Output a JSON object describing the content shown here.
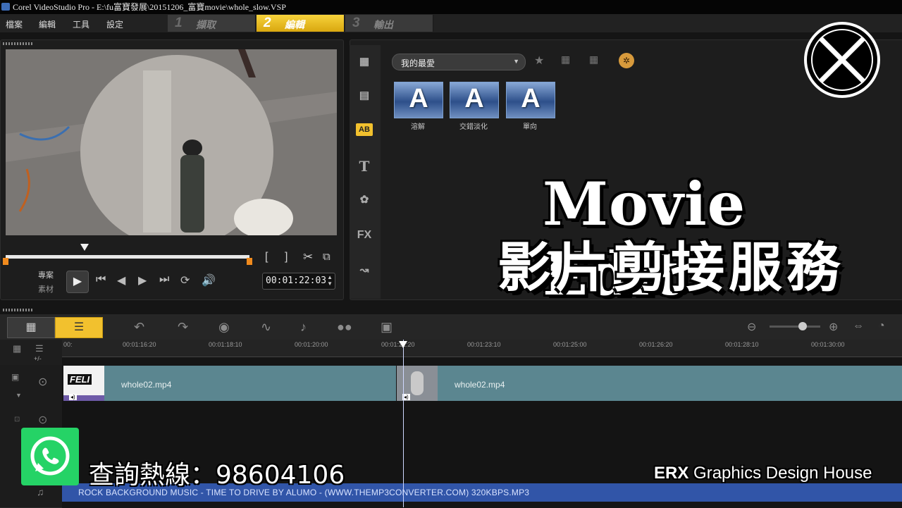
{
  "window": {
    "title": "Corel VideoStudio Pro - E:\\fu富寶發展\\20151206_富寶movie\\whole_slow.VSP"
  },
  "menu": [
    "檔案",
    "編輯",
    "工具",
    "設定"
  ],
  "steps": [
    {
      "num": "1",
      "label": "擷取",
      "active": false
    },
    {
      "num": "2",
      "label": "編輯",
      "active": true
    },
    {
      "num": "3",
      "label": "輸出",
      "active": false
    }
  ],
  "player": {
    "mode_project": "專案",
    "mode_clip": "素材",
    "timecode": "00:01:22:03",
    "mark_in": "[",
    "mark_out": "]"
  },
  "library": {
    "folder_dropdown": "我的最愛",
    "tabs": [
      "media-icon",
      "instant-project-icon",
      "transition-icon",
      "title-icon",
      "graphic-icon",
      "filter-icon",
      "path-icon"
    ],
    "tab_fx_text": "FX",
    "tab_title_text": "T",
    "tab_transition_text": "AB",
    "thumbnails": [
      {
        "letter": "A",
        "label": "溶解"
      },
      {
        "letter": "A",
        "label": "交錯淡化"
      },
      {
        "letter": "A",
        "label": "單向"
      }
    ]
  },
  "timeline": {
    "ruler_ticks": [
      "00:",
      "00:01:16:20",
      "00:01:18:10",
      "00:01:20:00",
      "00:01:21:20",
      "00:01:23:10",
      "00:01:25:00",
      "00:01:26:20",
      "00:01:28:10",
      "00:01:30:00"
    ],
    "video_clips": [
      {
        "name": "whole02.mp4",
        "thumb_text": "FELI"
      },
      {
        "name": "whole02.mp4",
        "thumb_text": ""
      }
    ],
    "track_add_label": "+/-",
    "audio_clip": "ROCK BACKGROUND MUSIC - TIME TO DRIVE BY ALUMO - (WWW.THEMP3CONVERTER.COM) 320KBPS.MP3"
  },
  "overlay": {
    "headline_en": "Movie Edit",
    "headline_zh": "影片剪接服務",
    "hotline": "查詢熱線：98604106",
    "brand_bold": "ERX",
    "brand_rest": " Graphics Design House"
  },
  "colors": {
    "accent": "#f2c12e",
    "clip": "#5b8690",
    "audio": "#3155a8",
    "whatsapp": "#25d366"
  }
}
